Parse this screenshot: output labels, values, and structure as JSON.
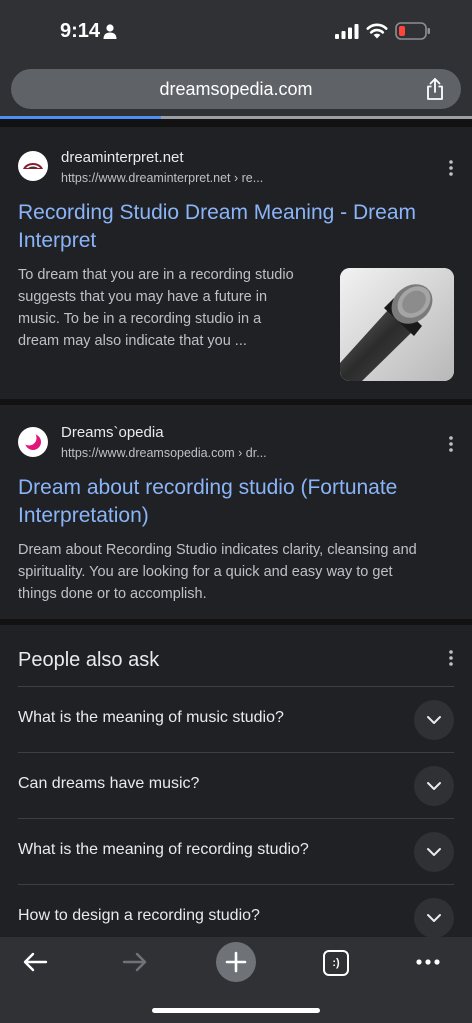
{
  "status": {
    "time": "9:14"
  },
  "browser": {
    "url": "dreamsopedia.com",
    "tab_count": ":)"
  },
  "results": [
    {
      "site": "dreaminterpret.net",
      "url": "https://www.dreaminterpret.net › re...",
      "title_line1": "Recording Studio Dream Meaning - Dream",
      "title_line2": "Interpret",
      "snippet": [
        "To dream that you are in a recording studio",
        "suggests that you may have a future in",
        "music. To be in a recording studio in a",
        "dream may also indicate that you ..."
      ]
    },
    {
      "site": "Dreams`opedia",
      "url": "https://www.dreamsopedia.com › dr...",
      "title_line1": "Dream about recording studio (Fortunate",
      "title_line2": "Interpretation)",
      "snippet": [
        "Dream about Recording Studio indicates clarity, cleansing and",
        "spirituality. You are looking for a quick and easy way to get",
        "things done or to accomplish."
      ]
    }
  ],
  "paa": {
    "title": "People also ask",
    "questions": [
      "What is the meaning of music studio?",
      "Can dreams have music?",
      "What is the meaning of recording studio?",
      "How to design a recording studio?"
    ]
  },
  "colors": {
    "link": "#8ab4f8",
    "progress": "#4f8ef7",
    "battery_low": "#ff453a"
  },
  "icons": [
    "person-icon",
    "signal-icon",
    "wifi-icon",
    "battery-icon",
    "share-icon",
    "more-vert-icon",
    "chevron-down-icon",
    "back-arrow-icon",
    "forward-arrow-icon",
    "new-tab-plus-icon",
    "tabs-icon",
    "menu-dots-icon"
  ]
}
